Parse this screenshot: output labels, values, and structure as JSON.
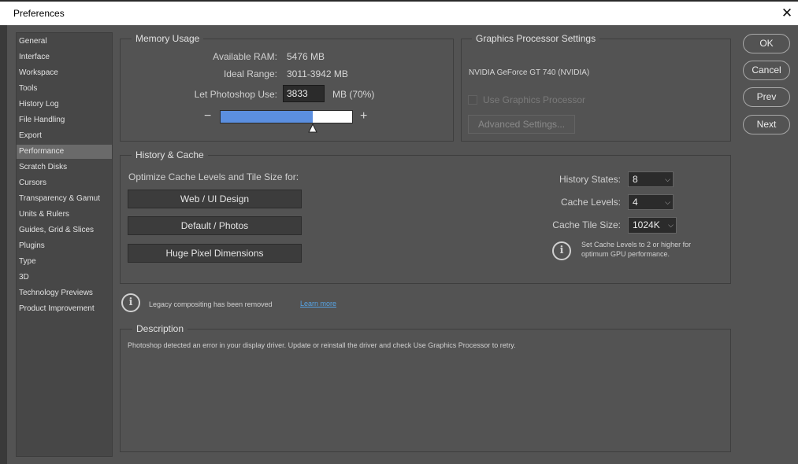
{
  "window": {
    "title": "Preferences"
  },
  "sidebar": {
    "items": [
      {
        "label": "General"
      },
      {
        "label": "Interface"
      },
      {
        "label": "Workspace"
      },
      {
        "label": "Tools"
      },
      {
        "label": "History Log"
      },
      {
        "label": "File Handling"
      },
      {
        "label": "Export"
      },
      {
        "label": "Performance"
      },
      {
        "label": "Scratch Disks"
      },
      {
        "label": "Cursors"
      },
      {
        "label": "Transparency & Gamut"
      },
      {
        "label": "Units & Rulers"
      },
      {
        "label": "Guides, Grid & Slices"
      },
      {
        "label": "Plugins"
      },
      {
        "label": "Type"
      },
      {
        "label": "3D"
      },
      {
        "label": "Technology Previews"
      },
      {
        "label": "Product Improvement"
      }
    ],
    "selected": "Performance"
  },
  "memory": {
    "title": "Memory Usage",
    "available_label": "Available RAM:",
    "available_value": "5476 MB",
    "ideal_label": "Ideal Range:",
    "ideal_value": "3011-3942 MB",
    "let_label": "Let Photoshop Use:",
    "let_value": "3833",
    "let_unit": "MB (70%)",
    "minus": "−",
    "plus": "+",
    "slider_fraction": 0.7
  },
  "gpu": {
    "title": "Graphics Processor Settings",
    "device": "NVIDIA GeForce GT 740 (NVIDIA)",
    "use_label": "Use Graphics Processor",
    "use_checked": false,
    "advanced": "Advanced Settings..."
  },
  "history": {
    "title": "History & Cache",
    "optimize_label": "Optimize Cache Levels and Tile Size for:",
    "presets": [
      "Web / UI Design",
      "Default / Photos",
      "Huge Pixel Dimensions"
    ],
    "states_label": "History States:",
    "states_value": "8",
    "levels_label": "Cache Levels:",
    "levels_value": "4",
    "tile_label": "Cache Tile Size:",
    "tile_value": "1024K",
    "note_line1": "Set Cache Levels to 2 or higher for",
    "note_line2": "optimum GPU performance."
  },
  "legacy": {
    "text": "Legacy compositing has been removed",
    "link": "Learn more"
  },
  "description": {
    "title": "Description",
    "text": "Photoshop detected an error in your display driver. Update or reinstall the driver and check Use Graphics Processor to retry."
  },
  "buttons": {
    "ok": "OK",
    "cancel": "Cancel",
    "prev": "Prev",
    "next": "Next"
  },
  "icons": {
    "close": "close-icon",
    "info": "info-icon",
    "chevron": "chevron-down-icon"
  },
  "colors": {
    "slider_fill": "#5b8fe0",
    "link": "#57a4e5",
    "background": "#535353"
  }
}
